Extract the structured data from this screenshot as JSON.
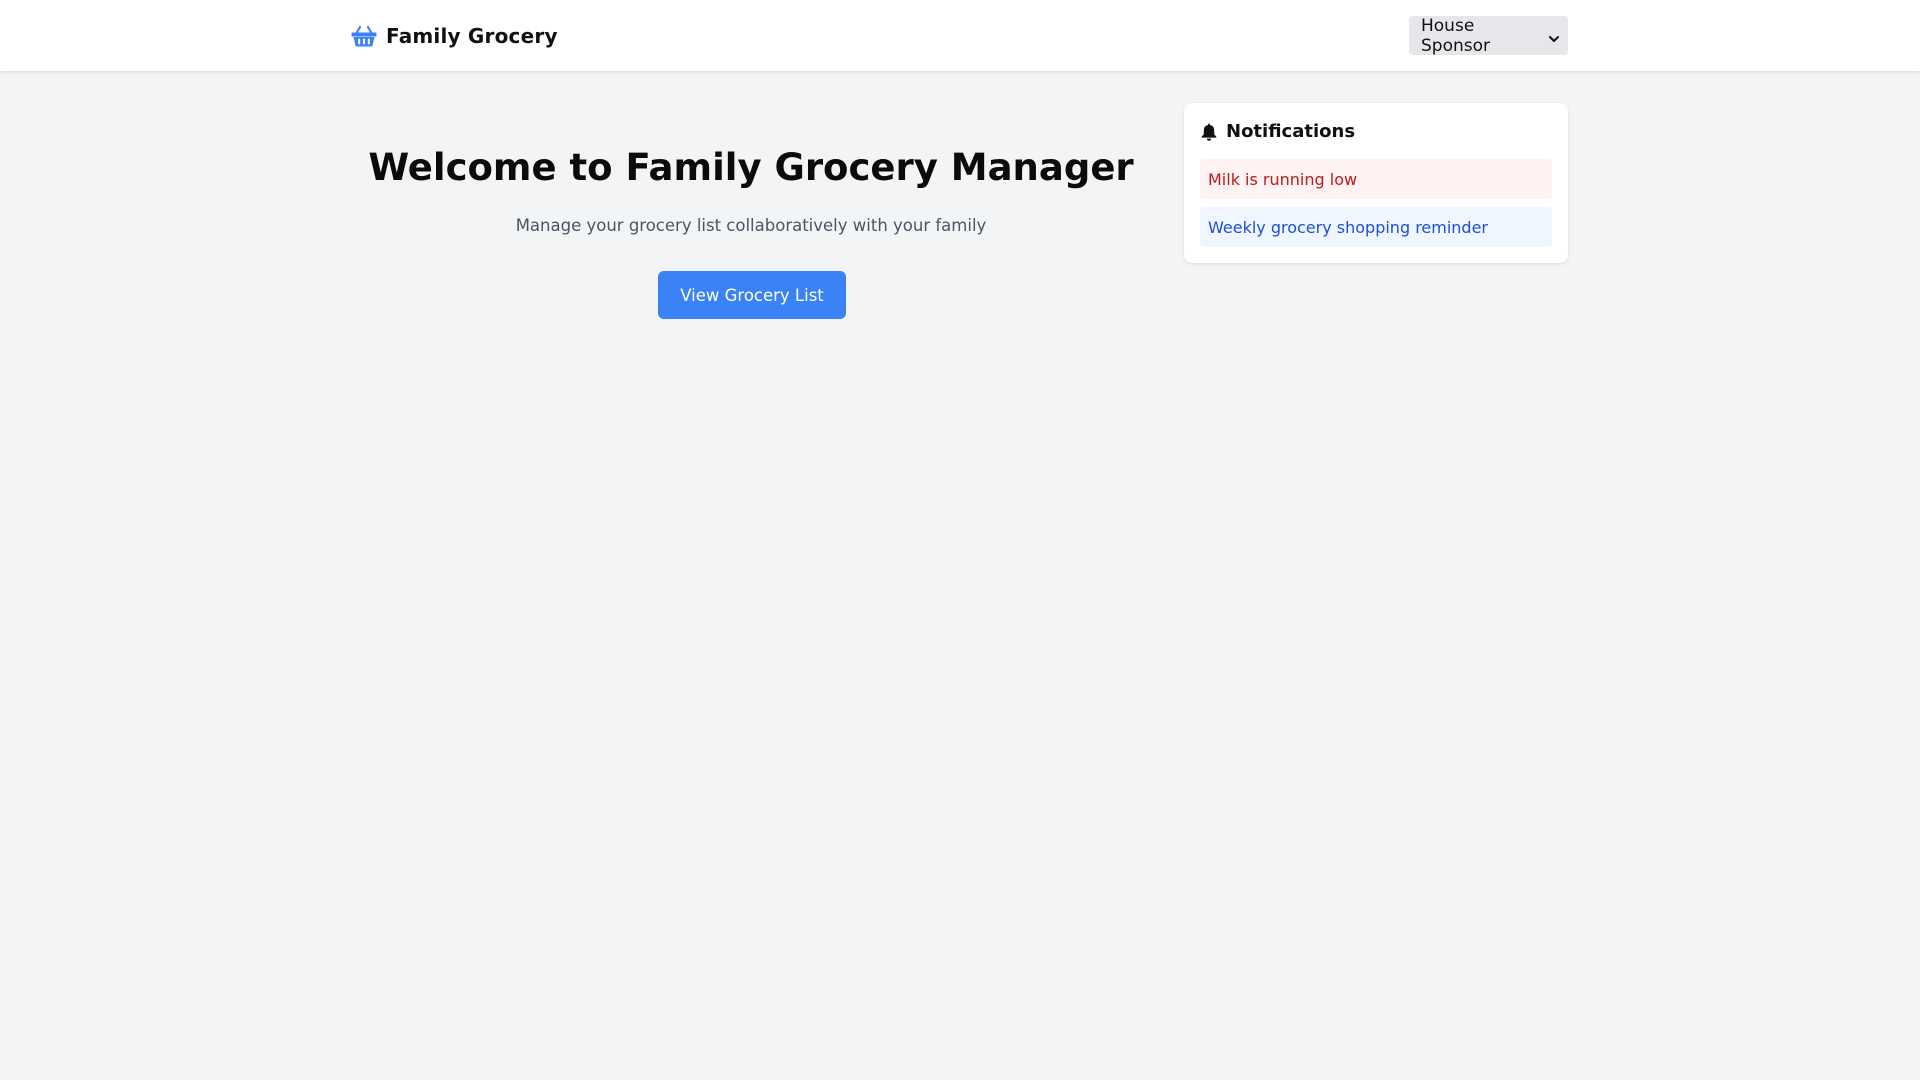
{
  "header": {
    "brand_icon": "basket-icon",
    "brand_name": "Family Grocery",
    "role_select": {
      "selected": "House Sponsor",
      "icon": "chevron-down-icon"
    }
  },
  "hero": {
    "title": "Welcome to Family Grocery Manager",
    "subtitle": "Manage your grocery list collaboratively with your family",
    "button_label": "View Grocery List"
  },
  "notifications": {
    "icon": "bell-icon",
    "title": "Notifications",
    "items": [
      {
        "text": "Milk is running low",
        "kind": "alert"
      },
      {
        "text": "Weekly grocery shopping reminder",
        "kind": "info"
      }
    ]
  },
  "colors": {
    "accent": "#3b82f6",
    "page_background": "#f3f4f6",
    "alert_text": "#b91c1c",
    "alert_background": "#fef2f2",
    "info_text": "#1d4ed8",
    "info_background": "#eff6ff"
  }
}
